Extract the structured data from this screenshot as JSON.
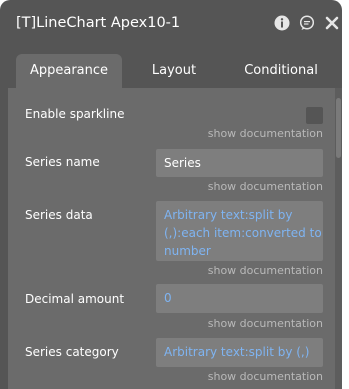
{
  "window": {
    "title": "[T]LineChart Apex10-1",
    "icons": [
      "info-icon",
      "comment-icon",
      "close-icon"
    ]
  },
  "tabs": [
    {
      "label": "Appearance",
      "active": true
    },
    {
      "label": "Layout",
      "active": false
    },
    {
      "label": "Conditional",
      "active": false
    }
  ],
  "fields": {
    "enable_sparkline": {
      "label": "Enable sparkline",
      "checked": false,
      "doc": "show documentation"
    },
    "series_name": {
      "label": "Series name",
      "value": "Series",
      "doc": "show documentation"
    },
    "series_data": {
      "label": "Series data",
      "line1": "Arbitrary text:split by",
      "line2": "(,):each item:converted to",
      "line3": "number",
      "doc": "show documentation"
    },
    "decimal_amount": {
      "label": "Decimal amount",
      "value": "0",
      "doc": "show documentation"
    },
    "series_category": {
      "label": "Series category",
      "value": "Arbitrary text:split by (,)",
      "doc": "show documentation"
    }
  },
  "colors": {
    "panel_bg": "#555555",
    "content_bg": "#6b6b6b",
    "field_bg": "#7e7e7e",
    "dynamic_text": "#7fb4f2",
    "doc_text": "#b9b9b9"
  }
}
